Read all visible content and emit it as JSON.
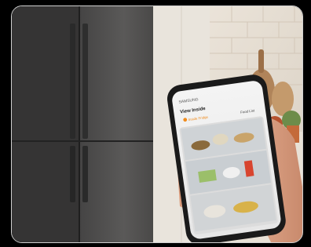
{
  "phone": {
    "brand": "SAMSUNG",
    "screen_title": "View Inside",
    "tab_inside_fridge": "Inside Fridge",
    "tab_food_list": "Food List"
  },
  "colors": {
    "background": "#000000",
    "frame_border": "#cfcfcf",
    "accent_orange": "#f08c1e"
  }
}
